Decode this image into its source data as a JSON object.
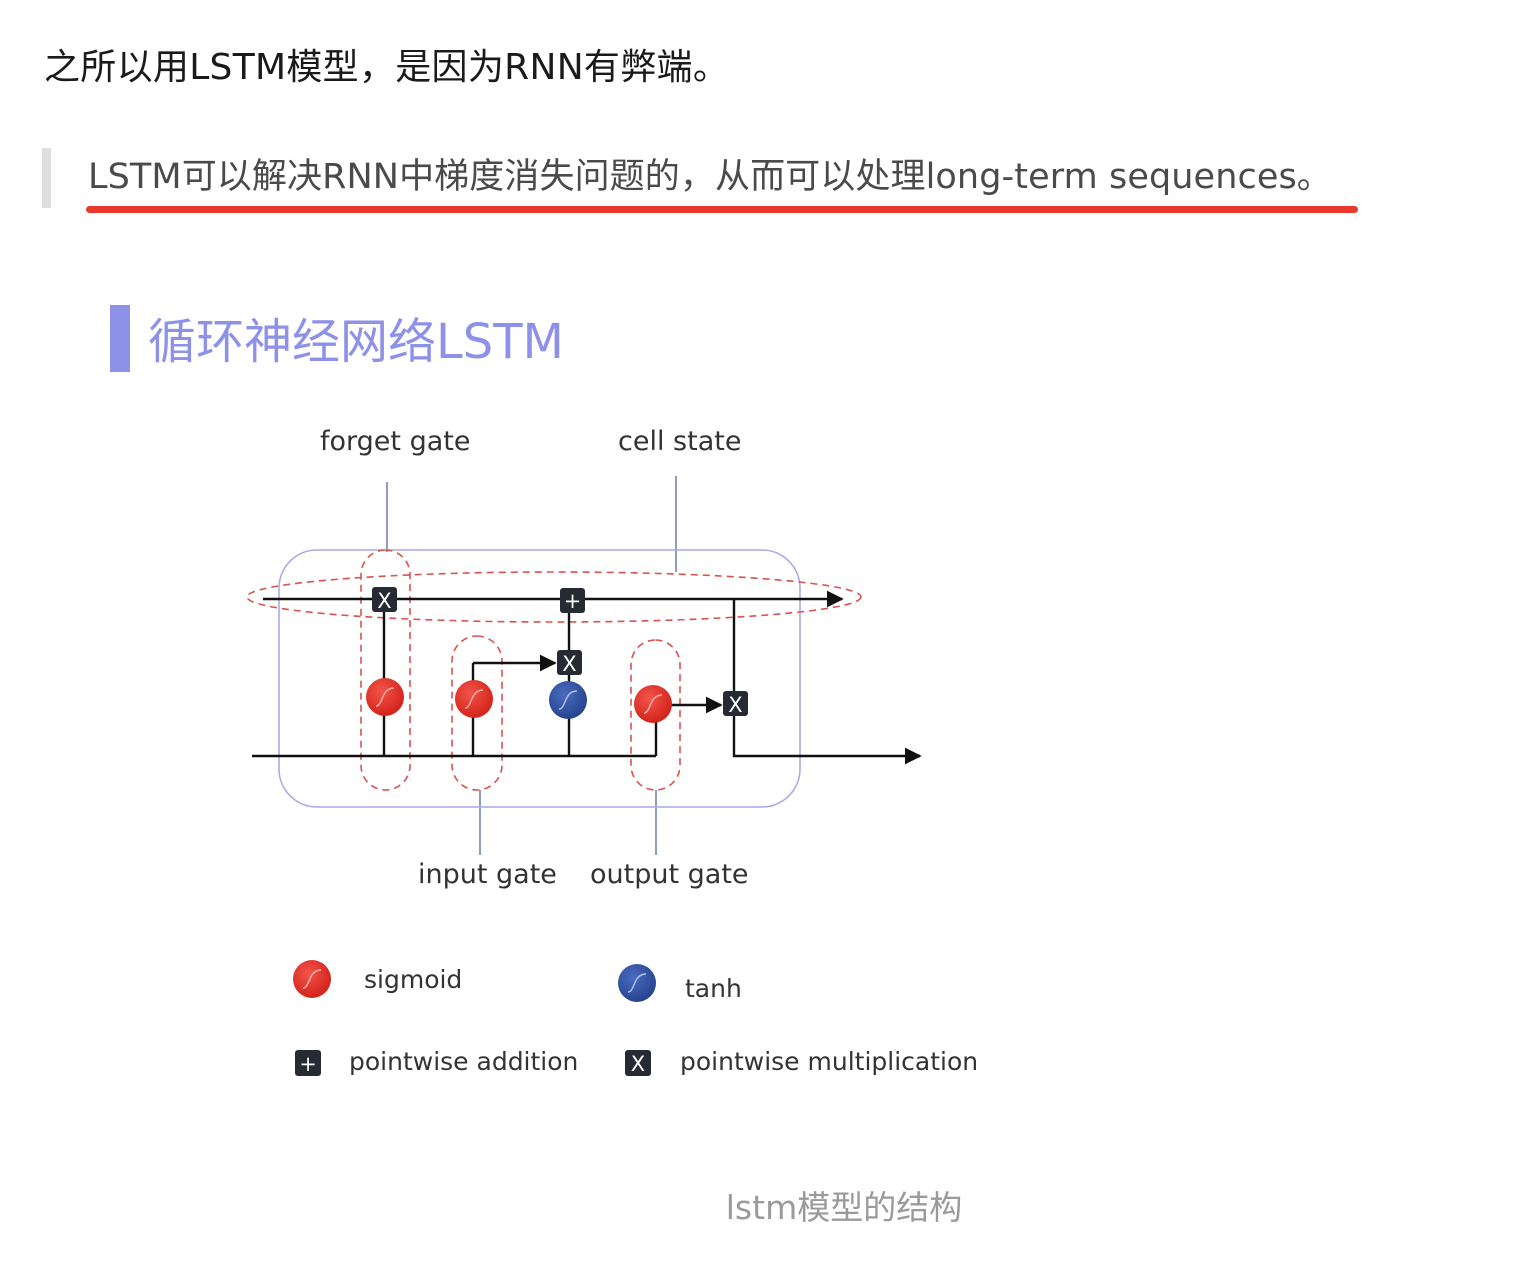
{
  "intro": {
    "text": "之所以用LSTM模型，是因为RNN有弊端。"
  },
  "quote": {
    "text": "LSTM可以解决RNN中梯度消失问题的，从而可以处理long-term sequences。"
  },
  "figure": {
    "heading": "循环神经网络LSTM",
    "labels": {
      "forget_gate": "forget gate",
      "cell_state": "cell state",
      "input_gate": "input gate",
      "output_gate": "output gate"
    },
    "op_symbols": {
      "multiply": "X",
      "add": "+"
    },
    "legend": [
      {
        "label": "sigmoid",
        "icon": "sigmoid-icon",
        "color": "#e52a1f"
      },
      {
        "label": "tanh",
        "icon": "tanh-icon",
        "color": "#2e4f9f"
      },
      {
        "label": "pointwise addition",
        "icon": "plus-icon",
        "color": "#262b33"
      },
      {
        "label": "pointwise multiplication",
        "icon": "multiply-icon",
        "color": "#262b33"
      }
    ],
    "colors": {
      "heading": "#8d92e8",
      "heading_bar": "#8d92e8",
      "sigmoid": "#e52a1f",
      "tanh": "#2e4f9f",
      "operator": "#262b33",
      "dashed_outline": "#d9534f",
      "cell_box": "#a9a9e6"
    }
  },
  "caption": {
    "text": "lstm模型的结构"
  }
}
